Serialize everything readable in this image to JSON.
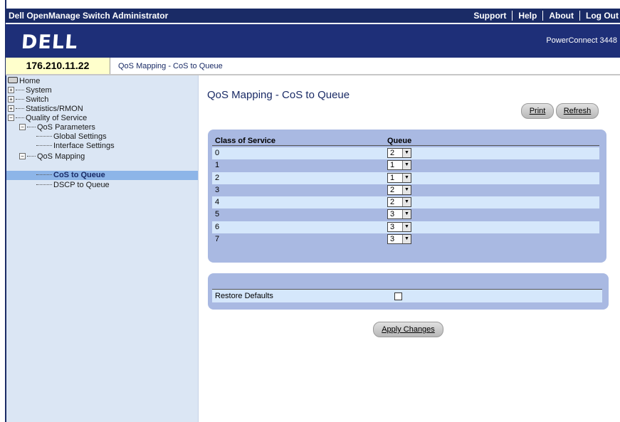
{
  "header": {
    "app_title": "Dell OpenManage Switch Administrator",
    "nav": [
      "Support",
      "Help",
      "About",
      "Log Out"
    ],
    "logo": "DELL",
    "product": "PowerConnect 3448"
  },
  "address": {
    "ip": "176.210.11.22",
    "breadcrumb": "QoS Mapping - CoS to Queue"
  },
  "sidebar": {
    "home": "Home",
    "system": "System",
    "switch": "Switch",
    "statistics": "Statistics/RMON",
    "qos": "Quality of Service",
    "qos_parameters": "QoS Parameters",
    "global_settings": "Global Settings",
    "interface_settings": "Interface Settings",
    "qos_mapping": "QoS Mapping",
    "cos_to_queue": "CoS to Queue",
    "dscp_to_queue": "DSCP to Queue"
  },
  "main": {
    "title": "QoS Mapping - CoS to Queue",
    "print_label": "Print",
    "refresh_label": "Refresh",
    "col_cos": "Class of Service",
    "col_queue": "Queue",
    "rows": [
      {
        "cos": "0",
        "queue": "2"
      },
      {
        "cos": "1",
        "queue": "1"
      },
      {
        "cos": "2",
        "queue": "1"
      },
      {
        "cos": "3",
        "queue": "2"
      },
      {
        "cos": "4",
        "queue": "2"
      },
      {
        "cos": "5",
        "queue": "3"
      },
      {
        "cos": "6",
        "queue": "3"
      },
      {
        "cos": "7",
        "queue": "3"
      }
    ],
    "restore_label": "Restore Defaults",
    "restore_checked": false,
    "apply_label": "Apply Changes"
  },
  "colors": {
    "header_bg": "#1a2b66",
    "banner_bg": "#1e2f78",
    "panel_bg": "#a9b9e2",
    "row_light": "#d5e7fb",
    "sidebar_bg": "#dbe6f4",
    "selected": "#8db5e8"
  }
}
